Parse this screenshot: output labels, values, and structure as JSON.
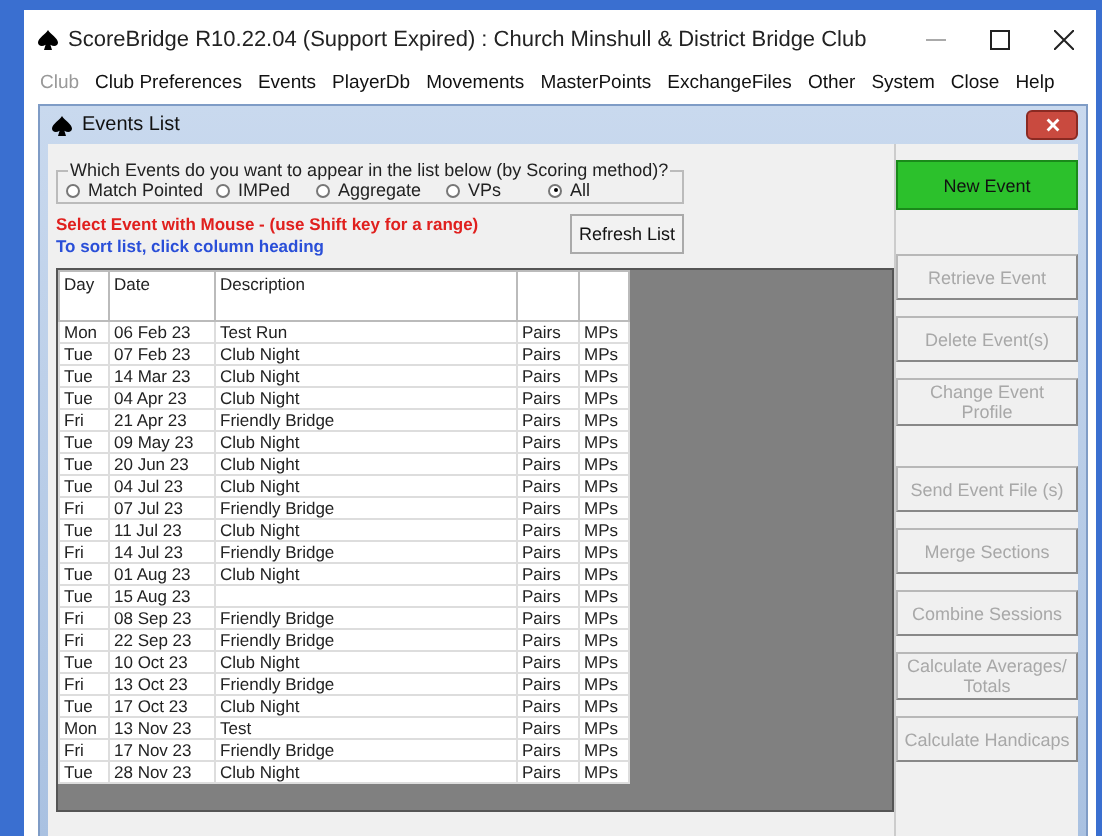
{
  "window": {
    "title": "ScoreBridge R10.22.04 (Support Expired) : Church Minshull & District Bridge Club"
  },
  "menu": [
    {
      "label": "Club",
      "disabled": true
    },
    {
      "label": "Club Preferences",
      "disabled": false
    },
    {
      "label": "Events",
      "disabled": false
    },
    {
      "label": "PlayerDb",
      "disabled": false
    },
    {
      "label": "Movements",
      "disabled": false
    },
    {
      "label": "MasterPoints",
      "disabled": false
    },
    {
      "label": "ExchangeFiles",
      "disabled": false
    },
    {
      "label": "Other",
      "disabled": false
    },
    {
      "label": "System",
      "disabled": false
    },
    {
      "label": "Close",
      "disabled": false
    },
    {
      "label": "Help",
      "disabled": false
    }
  ],
  "dialog": {
    "title": "Events List",
    "filter": {
      "legend": "Which Events do you want to appear in the list below (by Scoring method)?",
      "options": [
        {
          "label": "Match Pointed",
          "selected": false
        },
        {
          "label": "IMPed",
          "selected": false
        },
        {
          "label": "Aggregate",
          "selected": false
        },
        {
          "label": "VPs",
          "selected": false
        },
        {
          "label": "All",
          "selected": true
        }
      ]
    },
    "hint_select": "Select Event with Mouse - (use Shift key for a range)",
    "hint_sort": "To sort list, click column heading",
    "refresh_button": "Refresh List",
    "table": {
      "columns": [
        "Day",
        "Date",
        "Description"
      ],
      "rows": [
        [
          "Mon",
          "06 Feb 23",
          "Test Run",
          "Pairs",
          "MPs"
        ],
        [
          "Tue",
          "07 Feb 23",
          "Club Night",
          "Pairs",
          "MPs"
        ],
        [
          "Tue",
          "14 Mar 23",
          "Club Night",
          "Pairs",
          "MPs"
        ],
        [
          "Tue",
          "04 Apr 23",
          "Club Night",
          "Pairs",
          "MPs"
        ],
        [
          "Fri",
          "21 Apr 23",
          "Friendly Bridge",
          "Pairs",
          "MPs"
        ],
        [
          "Tue",
          "09 May 23",
          "Club Night",
          "Pairs",
          "MPs"
        ],
        [
          "Tue",
          "20 Jun 23",
          "Club Night",
          "Pairs",
          "MPs"
        ],
        [
          "Tue",
          "04 Jul 23",
          "Club Night",
          "Pairs",
          "MPs"
        ],
        [
          "Fri",
          "07 Jul 23",
          "Friendly Bridge",
          "Pairs",
          "MPs"
        ],
        [
          "Tue",
          "11 Jul 23",
          "Club Night",
          "Pairs",
          "MPs"
        ],
        [
          "Fri",
          "14 Jul 23",
          "Friendly Bridge",
          "Pairs",
          "MPs"
        ],
        [
          "Tue",
          "01 Aug 23",
          "Club Night",
          "Pairs",
          "MPs"
        ],
        [
          "Tue",
          "15 Aug 23",
          "",
          "Pairs",
          "MPs"
        ],
        [
          "Fri",
          "08 Sep 23",
          "Friendly Bridge",
          "Pairs",
          "MPs"
        ],
        [
          "Fri",
          "22 Sep 23",
          "Friendly Bridge",
          "Pairs",
          "MPs"
        ],
        [
          "Tue",
          "10 Oct 23",
          "Club Night",
          "Pairs",
          "MPs"
        ],
        [
          "Fri",
          "13 Oct 23",
          "Friendly Bridge",
          "Pairs",
          "MPs"
        ],
        [
          "Tue",
          "17 Oct 23",
          "Club Night",
          "Pairs",
          "MPs"
        ],
        [
          "Mon",
          "13 Nov 23",
          "Test",
          "Pairs",
          "MPs"
        ],
        [
          "Fri",
          "17 Nov 23",
          "Friendly Bridge",
          "Pairs",
          "MPs"
        ],
        [
          "Tue",
          "28 Nov 23",
          "Club Night",
          "Pairs",
          "MPs"
        ]
      ]
    },
    "actions": [
      {
        "label": "New Event",
        "disabled": false,
        "kind": "primary"
      },
      {
        "label": "Retrieve Event",
        "disabled": true,
        "kind": "normal"
      },
      {
        "label": "Delete Event(s)",
        "disabled": true,
        "kind": "normal"
      },
      {
        "label": "Change Event Profile",
        "disabled": true,
        "kind": "normal"
      },
      {
        "label": "Send Event File (s)",
        "disabled": true,
        "kind": "normal"
      },
      {
        "label": "Merge Sections",
        "disabled": true,
        "kind": "normal"
      },
      {
        "label": "Combine Sessions",
        "disabled": true,
        "kind": "normal"
      },
      {
        "label": "Calculate Averages/ Totals",
        "disabled": true,
        "kind": "normal"
      },
      {
        "label": "Calculate Handicaps",
        "disabled": true,
        "kind": "normal"
      }
    ]
  }
}
